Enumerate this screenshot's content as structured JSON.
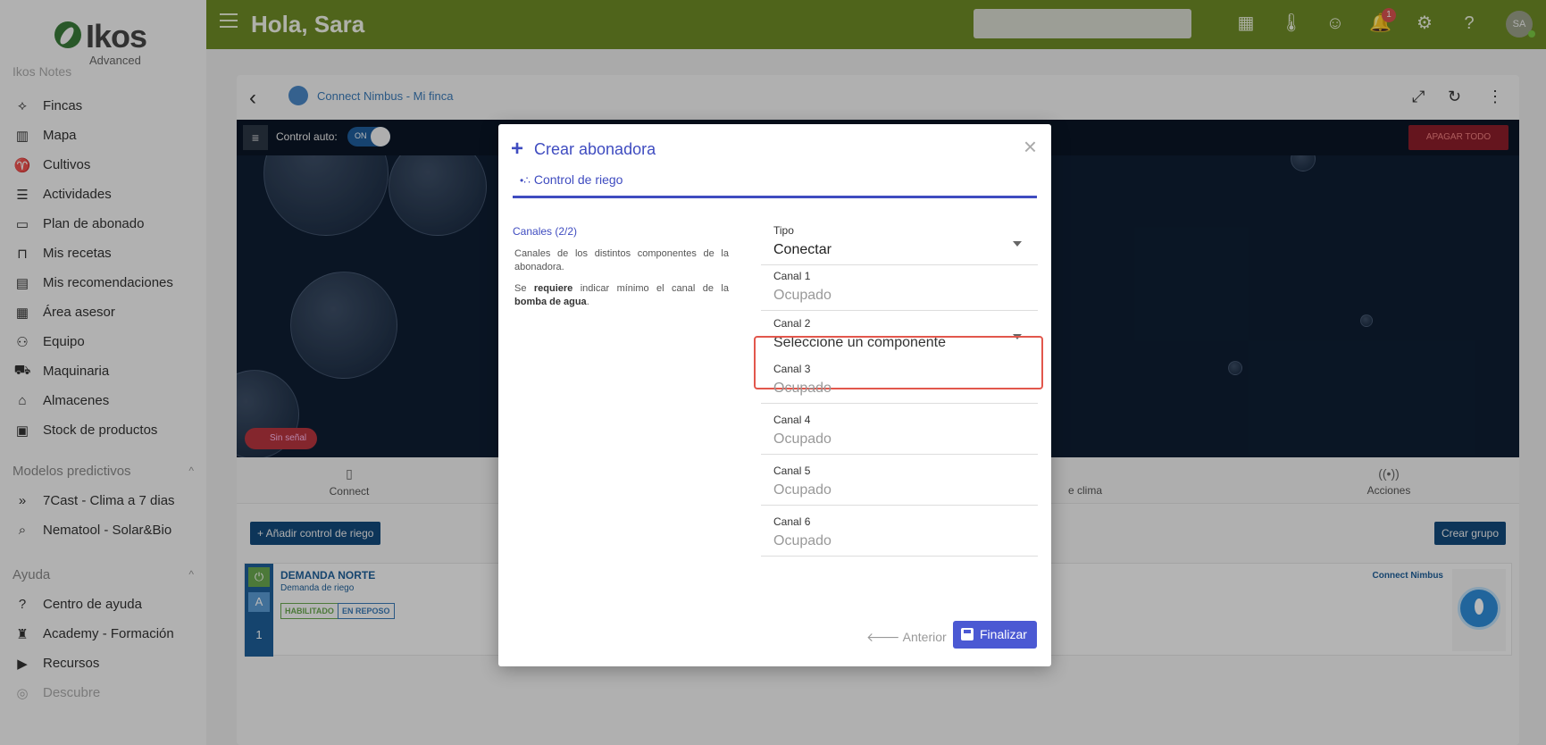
{
  "app": {
    "brand": "Ikos",
    "brand_sub": "Advanced",
    "greeting": "Hola, Sara",
    "avatar_initials": "SA",
    "notifications_count": "1"
  },
  "sidebar": {
    "faded_top": "Ikos Notes",
    "items": [
      {
        "label": "Fincas",
        "icon": "diamond-icon"
      },
      {
        "label": "Mapa",
        "icon": "map-icon"
      },
      {
        "label": "Cultivos",
        "icon": "sprout-icon"
      },
      {
        "label": "Actividades",
        "icon": "checklist-icon"
      },
      {
        "label": "Plan de abonado",
        "icon": "calendar-icon"
      },
      {
        "label": "Mis recetas",
        "icon": "bookmark-icon"
      },
      {
        "label": "Mis recomendaciones",
        "icon": "document-icon"
      },
      {
        "label": "Área asesor",
        "icon": "clipboard-icon"
      },
      {
        "label": "Equipo",
        "icon": "team-icon"
      },
      {
        "label": "Maquinaria",
        "icon": "tractor-icon"
      },
      {
        "label": "Almacenes",
        "icon": "warehouse-icon"
      },
      {
        "label": "Stock de productos",
        "icon": "box-icon"
      }
    ],
    "predictive_heading": "Modelos predictivos",
    "predictive_items": [
      {
        "label": "7Cast - Clima a 7 dias",
        "icon": "fast-forward-icon"
      },
      {
        "label": "Nematool - Solar&Bio",
        "icon": "search-bug-icon"
      }
    ],
    "help_heading": "Ayuda",
    "help_items": [
      {
        "label": "Centro de ayuda",
        "icon": "help-circle-icon"
      },
      {
        "label": "Academy - Formación",
        "icon": "academy-icon"
      },
      {
        "label": "Recursos",
        "icon": "play-icon"
      },
      {
        "label": "Descubre",
        "icon": "compass-icon"
      }
    ]
  },
  "card": {
    "title": "Connect Nimbus - Mi finca",
    "control_auto_label": "Control auto:",
    "toggle_on": "ON",
    "apagar_todo": "APAGAR TODO",
    "sin_senal": "Sin señal",
    "tabs": {
      "connect": "Connect",
      "clima": "e clima",
      "acciones": "Acciones"
    },
    "add_button": "+ Añadir control de riego",
    "group_button": "Crear grupo",
    "demand": {
      "name": "DEMANDA NORTE",
      "subtitle": "Demanda de riego",
      "tag1": "HABILITADO",
      "tag2": "EN REPOSO",
      "right_label": "Connect Nimbus",
      "rail_a": "A",
      "rail_num": "1"
    }
  },
  "modal": {
    "title": "Crear abonadora",
    "step": "Control de riego",
    "section": "Canales (2/2)",
    "desc1": "Canales de los distintos componentes de la abonadora.",
    "desc2_pre": "Se ",
    "desc2_bold1": "requiere",
    "desc2_mid": " indicar mínimo el canal de la ",
    "desc2_bold2": "bomba de agua",
    "desc2_post": ".",
    "fields": [
      {
        "label": "Tipo",
        "value": "Conectar"
      },
      {
        "label": "Canal 1",
        "value": "Ocupado"
      },
      {
        "label": "Canal 2",
        "value": "Seleccione un componente"
      },
      {
        "label": "Canal 3",
        "value": "Ocupado"
      },
      {
        "label": "Canal 4",
        "value": "Ocupado"
      },
      {
        "label": "Canal 5",
        "value": "Ocupado"
      },
      {
        "label": "Canal 6",
        "value": "Ocupado"
      }
    ],
    "prev_label": "Anterior",
    "finish_label": "Finalizar"
  },
  "colors": {
    "topbar": "#6e8b26",
    "accent": "#3f4cc0",
    "highlight": "#e2574c"
  }
}
